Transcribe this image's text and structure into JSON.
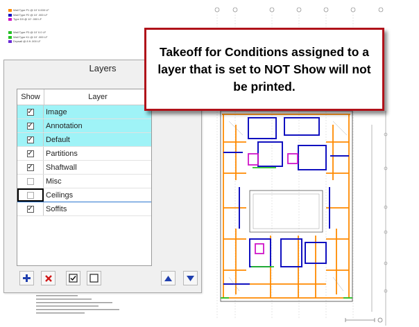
{
  "legend": {
    "group1": [
      {
        "label": "Wall Type P1 @ 10' 0.000 LF",
        "color": "#ff8a00"
      },
      {
        "label": "Wall Type P2 @ 10' .000 LF",
        "color": "#1010c0"
      },
      {
        "label": "Type D3 @ 10' .000 LF",
        "color": "#d014c8"
      }
    ],
    "group2": [
      {
        "label": "Wall Type P3 @ 10' 0.0 LF",
        "color": "#22c022"
      },
      {
        "label": "Wall Type K1 @ 10' .000 LF",
        "color": "#22c022"
      },
      {
        "label": "Drywall @ 8 ft .000 LF",
        "color": "#6a2ad6"
      }
    ]
  },
  "callout": {
    "text": "Takeoff for Conditions assigned to a layer that is set to NOT Show will not be printed."
  },
  "layers_panel": {
    "title": "Layers",
    "columns": {
      "show": "Show",
      "layer": "Layer"
    },
    "rows": [
      {
        "name": "Image",
        "show": true,
        "selected": true
      },
      {
        "name": "Annotation",
        "show": true,
        "selected": true
      },
      {
        "name": "Default",
        "show": true,
        "selected": true
      },
      {
        "name": "Partitions",
        "show": true,
        "selected": false
      },
      {
        "name": "Shaftwall",
        "show": true,
        "selected": false
      },
      {
        "name": "Misc",
        "show": false,
        "selected": false
      },
      {
        "name": "Ceilings",
        "show": false,
        "selected": false
      },
      {
        "name": "Soffits",
        "show": true,
        "selected": false
      }
    ],
    "toolbar_icons": [
      "add-icon",
      "delete-icon",
      "check-all-icon",
      "uncheck-all-icon",
      "move-up-icon",
      "move-down-icon"
    ]
  },
  "colors": {
    "selected_row": "#9ff3f7",
    "callout_border": "#b0121a",
    "wall_orange": "#ff8a00",
    "wall_blue": "#1010c0",
    "wall_magenta": "#d014c8",
    "wall_green": "#22c022"
  }
}
